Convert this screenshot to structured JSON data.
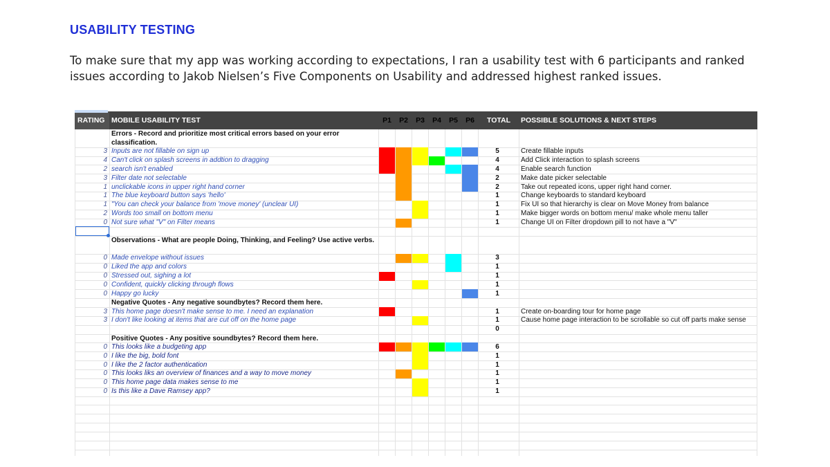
{
  "page": {
    "heading": "USABILITY TESTING",
    "intro": "To make sure that my app was working according to expectations, I ran a usability test with 6 participants and ranked issues according to Jakob Nielsen’s Five Components on Usability and addressed highest ranked issues."
  },
  "table": {
    "headers": {
      "rating": "RATING",
      "test": "MOBILE USABILITY TEST",
      "participants": [
        "P1",
        "P2",
        "P3",
        "P4",
        "P5",
        "P6"
      ],
      "total": "TOTAL",
      "solutions": "POSSIBLE SOLUTIONS & NEXT STEPS"
    },
    "participant_colors": [
      "#ff0000",
      "#ff9900",
      "#ffff00",
      "#00ff00",
      "#00ffff",
      "#4a86e8"
    ],
    "rows": [
      {
        "type": "section",
        "text": "Errors - Record and prioritize most critical errors based on your error classification."
      },
      {
        "type": "item",
        "rating": "3",
        "text": "Inputs are not fillable on sign up",
        "marks": [
          1,
          1,
          1,
          0,
          1,
          1
        ],
        "total": "5",
        "solution": "Create fillable inputs"
      },
      {
        "type": "item",
        "rating": "4",
        "text": "Can't click on splash screens in addtion to dragging",
        "marks": [
          1,
          1,
          1,
          1,
          0,
          0
        ],
        "total": "4",
        "solution": "Add Click interaction to splash screens"
      },
      {
        "type": "item",
        "rating": "2",
        "text": "search isn't enabled",
        "marks": [
          1,
          1,
          0,
          0,
          1,
          1
        ],
        "total": "4",
        "solution": "Enable search function"
      },
      {
        "type": "item",
        "rating": "3",
        "text": "Filter date not selectable",
        "marks": [
          0,
          1,
          0,
          0,
          0,
          1
        ],
        "total": "2",
        "solution": "Make date picker selectable"
      },
      {
        "type": "item",
        "rating": "1",
        "text": "unclickable icons in upper right hand corner",
        "marks": [
          0,
          1,
          0,
          0,
          0,
          1
        ],
        "total": "2",
        "solution": "Take out repeated icons, upper right hand corner."
      },
      {
        "type": "item",
        "rating": "1",
        "text": "The blue keyboard button says 'hello'",
        "marks": [
          0,
          1,
          0,
          0,
          0,
          0
        ],
        "total": "1",
        "solution": "Change keyboards to standard keyboard"
      },
      {
        "type": "item",
        "rating": "1",
        "text": "\"You can check your balance from 'move money' (unclear UI)",
        "marks": [
          0,
          0,
          1,
          0,
          0,
          0
        ],
        "total": "1",
        "solution": "Fix UI so that hierarchy is clear on Move Money from balance"
      },
      {
        "type": "item",
        "rating": "2",
        "text": "Words too small on bottom menu",
        "marks": [
          0,
          0,
          1,
          0,
          0,
          0
        ],
        "total": "1",
        "solution": "Make bigger words on bottom menu/ make whole menu taller"
      },
      {
        "type": "item",
        "rating": "0",
        "text": "Not sure what \"V\" on Filter means",
        "marks": [
          0,
          1,
          0,
          0,
          0,
          0
        ],
        "total": "1",
        "solution": "Change UI on Filter dropdown pill to not have a \"V\""
      },
      {
        "type": "blank"
      },
      {
        "type": "section",
        "text": "Observations - What are people Doing, Thinking, and Feeling? Use active verbs."
      },
      {
        "type": "item",
        "rating": "0",
        "text": "Made envelope without issues",
        "marks": [
          0,
          1,
          1,
          0,
          1,
          0
        ],
        "total": "3",
        "solution": ""
      },
      {
        "type": "item",
        "rating": "0",
        "text": "Liked the app and colors",
        "marks": [
          0,
          0,
          0,
          0,
          1,
          0
        ],
        "total": "1",
        "solution": ""
      },
      {
        "type": "item",
        "rating": "0",
        "text": "Stressed out, sighing a lot",
        "marks": [
          1,
          0,
          0,
          0,
          0,
          0
        ],
        "total": "1",
        "solution": ""
      },
      {
        "type": "item",
        "rating": "0",
        "text": "Confident, quickly clicking through flows",
        "marks": [
          0,
          0,
          1,
          0,
          0,
          0
        ],
        "total": "1",
        "solution": ""
      },
      {
        "type": "item",
        "rating": "0",
        "text": "Happy go lucky",
        "marks": [
          0,
          0,
          0,
          0,
          0,
          1
        ],
        "total": "1",
        "solution": ""
      },
      {
        "type": "section1",
        "text": "Negative Quotes - Any negative soundbytes? Record them here."
      },
      {
        "type": "item",
        "rating": "3",
        "text": "This home page doesn't make sense to me. I need an explanation",
        "marks": [
          1,
          0,
          0,
          0,
          0,
          0
        ],
        "total": "1",
        "solution": "Create on-boarding tour for home page"
      },
      {
        "type": "item",
        "rating": "3",
        "text": "I don't like looking at items that are cut off on the home page",
        "marks": [
          0,
          0,
          1,
          0,
          0,
          0
        ],
        "total": "1",
        "solution": "Cause home page interaction to be scrollable so cut off parts make sense"
      },
      {
        "type": "item",
        "rating": "",
        "text": "",
        "marks": [
          0,
          0,
          0,
          0,
          0,
          0
        ],
        "total": "0",
        "solution": ""
      },
      {
        "type": "section1",
        "text": "Positive Quotes - Any positive soundbytes? Record them here."
      },
      {
        "type": "item",
        "dark": true,
        "rating": "0",
        "text": "This looks like a budgeting app",
        "marks": [
          1,
          1,
          1,
          1,
          1,
          1
        ],
        "total": "6",
        "solution": ""
      },
      {
        "type": "item",
        "dark": true,
        "rating": "0",
        "text": "I like the big, bold font",
        "marks": [
          0,
          0,
          1,
          0,
          0,
          0
        ],
        "total": "1",
        "solution": ""
      },
      {
        "type": "item",
        "dark": true,
        "rating": "0",
        "text": "I like the 2 factor authentication",
        "marks": [
          0,
          0,
          1,
          0,
          0,
          0
        ],
        "total": "1",
        "solution": ""
      },
      {
        "type": "item",
        "dark": true,
        "rating": "0",
        "text": "This looks liks an overview of finances and a way to move money",
        "marks": [
          0,
          1,
          0,
          0,
          0,
          0
        ],
        "total": "1",
        "solution": ""
      },
      {
        "type": "item",
        "dark": true,
        "rating": "0",
        "text": "This home page data makes sense to me",
        "marks": [
          0,
          0,
          1,
          0,
          0,
          0
        ],
        "total": "1",
        "solution": ""
      },
      {
        "type": "item",
        "dark": true,
        "rating": "0",
        "text": "Is this like a Dave Ramsey app?",
        "marks": [
          0,
          0,
          1,
          0,
          0,
          0
        ],
        "total": "1",
        "solution": ""
      }
    ]
  }
}
